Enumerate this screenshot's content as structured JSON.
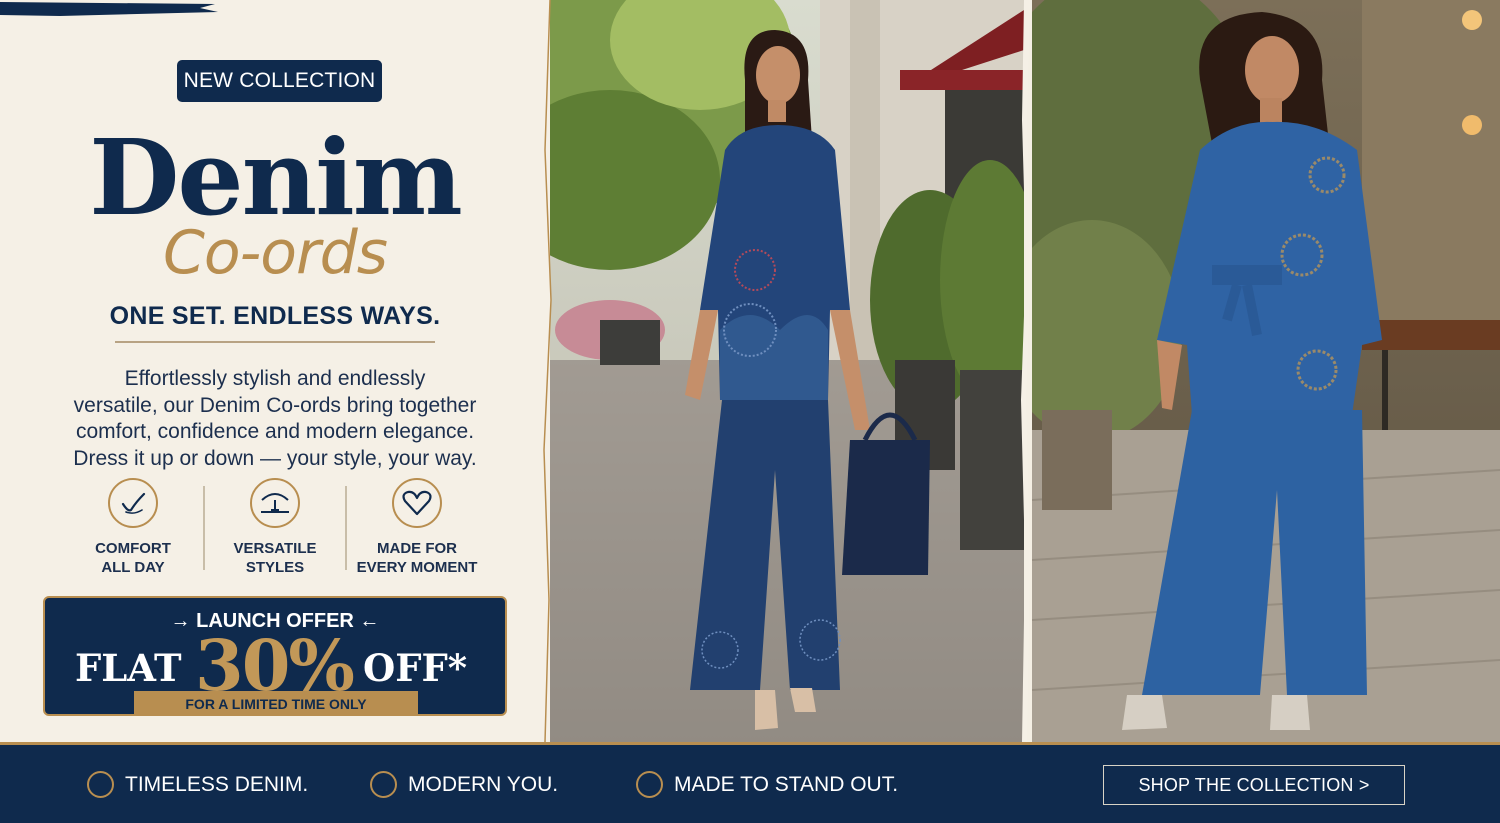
{
  "badge": "NEW COLLECTION",
  "title": "Denim",
  "subtitle": "Co-ords",
  "tagline": "ONE SET. ENDLESS WAYS.",
  "description": [
    "Effortlessly stylish and endlessly",
    "versatile, our Denim Co-ords bring together",
    "comfort, confidence and modern elegance.",
    "Dress it up or down — your style, your way."
  ],
  "features": [
    {
      "icon": "check-circle-icon",
      "label": "COMFORT\nALL DAY"
    },
    {
      "icon": "hanger-icon",
      "label": "VERSATILE\nSTYLES"
    },
    {
      "icon": "heart-icon",
      "label": "MADE FOR\nEVERY MOMENT"
    }
  ],
  "offer": {
    "title": "→ LAUNCH OFFER ←",
    "flat": "FLAT",
    "percent": "30%",
    "off": "OFF*",
    "note": "FOR A LIMITED TIME ONLY"
  },
  "bottom": {
    "items": [
      "TIMELESS DENIM.",
      "MODERN YOU.",
      "MADE TO STAND OUT."
    ],
    "cta": "SHOP THE COLLECTION  >"
  },
  "colors": {
    "navy": "#0f2a4d",
    "gold": "#b88e50",
    "cream": "#f5f0e6"
  }
}
